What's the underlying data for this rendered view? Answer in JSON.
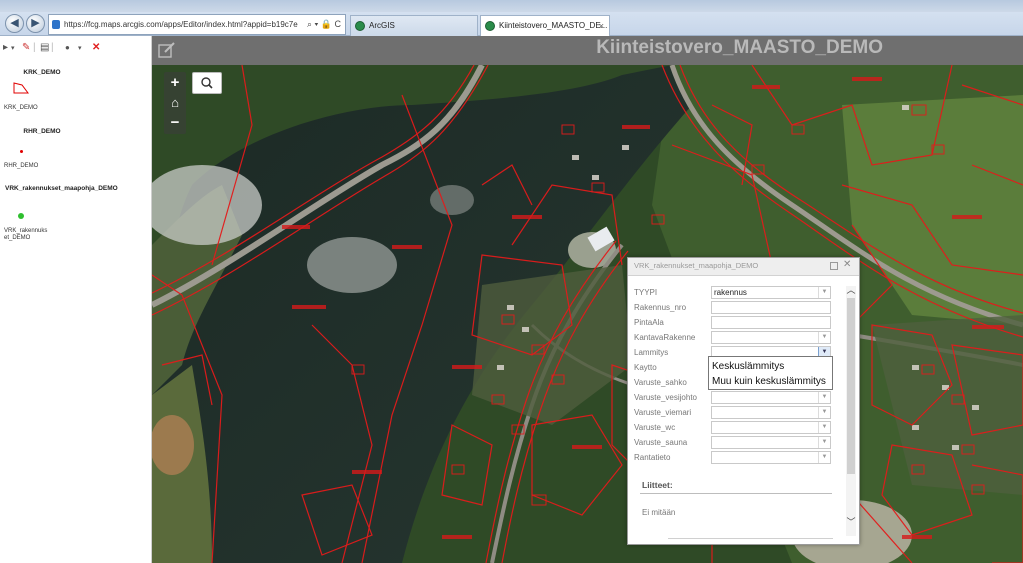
{
  "browser": {
    "address": "https://fcg.maps.arcgis.com/apps/Editor/index.html?appid=b19c7e",
    "address_controls": "⌕ ▾ 🔒 C",
    "tabs": [
      {
        "label": "ArcGIS",
        "active": false
      },
      {
        "label": "Kiinteistovero_MAASTO_DE...",
        "active": true
      }
    ],
    "tab_close": "×"
  },
  "legend": {
    "toolbar_icons": [
      "pointer-tool-icon",
      "eraser-icon",
      "page-icon",
      "point-tool-icon",
      "delete-icon"
    ],
    "layers": [
      {
        "title": "KRK_DEMO",
        "label": "KRK_DEMO",
        "symbol": "polygon",
        "color": "#e00000"
      },
      {
        "title": "RHR_DEMO",
        "label": "RHR_DEMO",
        "symbol": "point",
        "color": "#e00000"
      },
      {
        "title": "VRK_rakennukset_maapohja_DEMO",
        "label": "VRK_rakennukset_DEMO",
        "symbol": "point",
        "color": "#2fbf2f"
      }
    ]
  },
  "app": {
    "title": "Kiinteistovero_MAASTO_DEMO"
  },
  "map_controls": {
    "zoom_in": "+",
    "home": "⌂",
    "zoom_out": "−"
  },
  "popup": {
    "title": "VRK_rakennukset_maapohja_DEMO",
    "fields": [
      {
        "label": "TYYPI",
        "value": "rakennus",
        "type": "select"
      },
      {
        "label": "Rakennus_nro",
        "value": "",
        "type": "text"
      },
      {
        "label": "PintaAla",
        "value": "",
        "type": "text"
      },
      {
        "label": "KantavaRakenne",
        "value": "",
        "type": "select"
      },
      {
        "label": "Lammitys",
        "value": "",
        "type": "select",
        "open": true
      },
      {
        "label": "Kaytto",
        "value": "",
        "type": "select"
      },
      {
        "label": "Varuste_sahko",
        "value": "",
        "type": "select"
      },
      {
        "label": "Varuste_vesijohto",
        "value": "",
        "type": "select"
      },
      {
        "label": "Varuste_viemari",
        "value": "",
        "type": "select"
      },
      {
        "label": "Varuste_wc",
        "value": "",
        "type": "select"
      },
      {
        "label": "Varuste_sauna",
        "value": "",
        "type": "select"
      },
      {
        "label": "Rantatieto",
        "value": "",
        "type": "select"
      }
    ],
    "dropdown_options": [
      "Keskuslämmitys",
      "Muu kuin keskuslämmitys"
    ],
    "attachments_label": "Liitteet:",
    "attachments_empty": "Ei mitään"
  },
  "colors": {
    "parcel_line": "#e31b1b",
    "header_bg": "#6f6f6f",
    "title_text": "#b9b9b9"
  }
}
